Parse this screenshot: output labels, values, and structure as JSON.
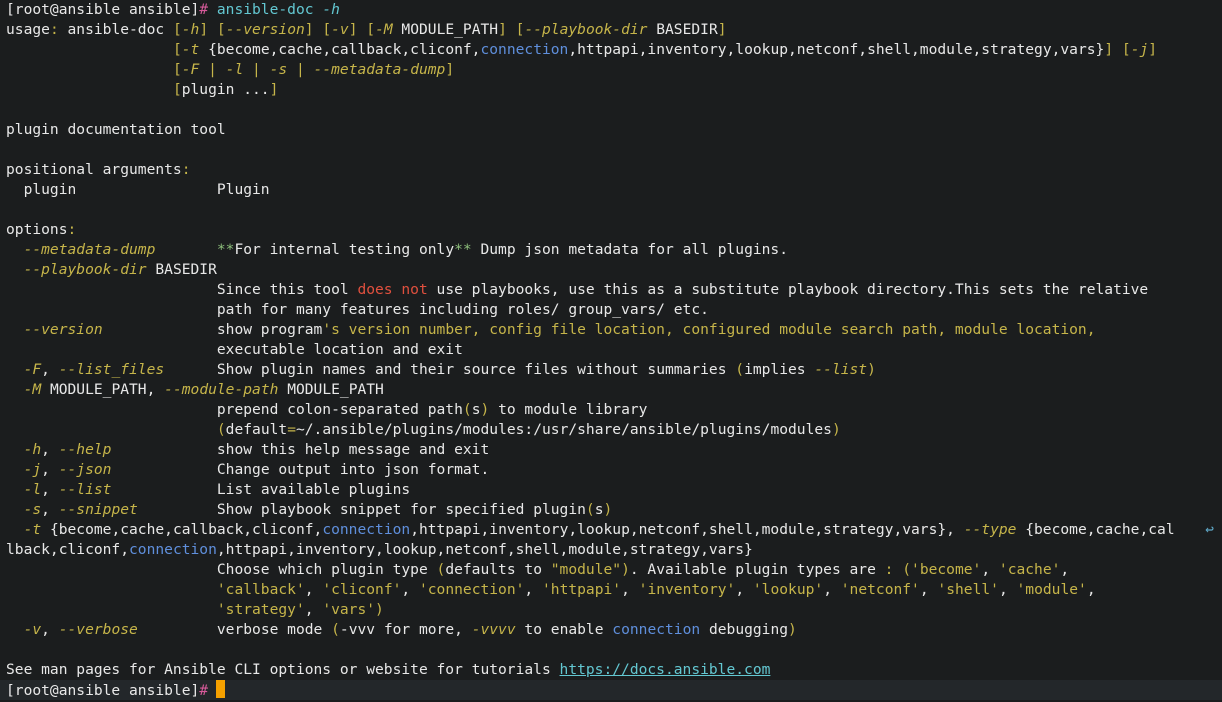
{
  "colors": {
    "background": "#1b1d1e",
    "text": "#e8e8e8",
    "yellow": "#c6b54a",
    "blue": "#5f8fdc",
    "red": "#e0503e",
    "green": "#8ec07c",
    "prompt_hash": "#d75a9a",
    "command": "#63c7d1",
    "cursor": "#f5a100"
  },
  "icons": {
    "line_wrap": "↩",
    "cursor": "block-cursor"
  },
  "lines": [
    [
      {
        "t": "[root@ansible ansible]",
        "c": "w"
      },
      {
        "t": "# ",
        "c": "pk"
      },
      {
        "t": "ansible-doc ",
        "c": "cy"
      },
      {
        "t": "-h",
        "c": "cyi"
      }
    ],
    [
      {
        "t": "usage",
        "c": "w"
      },
      {
        "t": ": ",
        "c": "y"
      },
      {
        "t": "ansible-doc ",
        "c": "w"
      },
      {
        "t": "[",
        "c": "y"
      },
      {
        "t": "-h",
        "c": "yi"
      },
      {
        "t": "] [",
        "c": "y"
      },
      {
        "t": "--version",
        "c": "yi"
      },
      {
        "t": "] [",
        "c": "y"
      },
      {
        "t": "-v",
        "c": "yi"
      },
      {
        "t": "] [",
        "c": "y"
      },
      {
        "t": "-M",
        "c": "yi"
      },
      {
        "t": " MODULE_PATH",
        "c": "w"
      },
      {
        "t": "] [",
        "c": "y"
      },
      {
        "t": "--playbook-dir",
        "c": "yi"
      },
      {
        "t": " BASEDIR",
        "c": "w"
      },
      {
        "t": "]",
        "c": "y"
      }
    ],
    [
      {
        "t": "                   ",
        "c": "w"
      },
      {
        "t": "[",
        "c": "y"
      },
      {
        "t": "-t",
        "c": "yi"
      },
      {
        "t": " {become,cache,callback,cliconf,",
        "c": "w"
      },
      {
        "t": "connection",
        "c": "b"
      },
      {
        "t": ",httpapi,inventory,lookup,netconf,shell,module,strategy,vars}",
        "c": "w"
      },
      {
        "t": "] [",
        "c": "y"
      },
      {
        "t": "-j",
        "c": "yi"
      },
      {
        "t": "]",
        "c": "y"
      }
    ],
    [
      {
        "t": "                   ",
        "c": "w"
      },
      {
        "t": "[",
        "c": "y"
      },
      {
        "t": "-F",
        "c": "yi"
      },
      {
        "t": " | ",
        "c": "y"
      },
      {
        "t": "-l",
        "c": "yi"
      },
      {
        "t": " | ",
        "c": "y"
      },
      {
        "t": "-s",
        "c": "yi"
      },
      {
        "t": " | ",
        "c": "y"
      },
      {
        "t": "--metadata-dump",
        "c": "yi"
      },
      {
        "t": "]",
        "c": "y"
      }
    ],
    [
      {
        "t": "                   ",
        "c": "w"
      },
      {
        "t": "[",
        "c": "y"
      },
      {
        "t": "plugin ...",
        "c": "w"
      },
      {
        "t": "]",
        "c": "y"
      }
    ],
    [],
    [
      {
        "t": "plugin documentation tool",
        "c": "w"
      }
    ],
    [],
    [
      {
        "t": "positional arguments",
        "c": "w"
      },
      {
        "t": ":",
        "c": "y"
      }
    ],
    [
      {
        "t": "  plugin                Plugin",
        "c": "w"
      }
    ],
    [],
    [
      {
        "t": "options",
        "c": "w"
      },
      {
        "t": ":",
        "c": "y"
      }
    ],
    [
      {
        "t": "  ",
        "c": "w"
      },
      {
        "t": "--metadata-dump",
        "c": "yi"
      },
      {
        "t": "       ",
        "c": "w"
      },
      {
        "t": "**",
        "c": "g"
      },
      {
        "t": "For internal testing only",
        "c": "w"
      },
      {
        "t": "**",
        "c": "g"
      },
      {
        "t": " Dump json metadata for all plugins.",
        "c": "w"
      }
    ],
    [
      {
        "t": "  ",
        "c": "w"
      },
      {
        "t": "--playbook-dir",
        "c": "yi"
      },
      {
        "t": " BASEDIR",
        "c": "w"
      }
    ],
    [
      {
        "t": "                        Since this tool ",
        "c": "w"
      },
      {
        "t": "does not",
        "c": "r"
      },
      {
        "t": " use playbooks, use this as a substitute playbook directory.This sets the relative",
        "c": "w"
      }
    ],
    [
      {
        "t": "                        path for many features including roles/ group_vars/ etc.",
        "c": "w"
      }
    ],
    [
      {
        "t": "  ",
        "c": "w"
      },
      {
        "t": "--version",
        "c": "yi"
      },
      {
        "t": "             show program",
        "c": "w"
      },
      {
        "t": "'s version number, config file location, configured module search path, module location,",
        "c": "y"
      }
    ],
    [
      {
        "t": "                        executable location and exit",
        "c": "w"
      }
    ],
    [
      {
        "t": "  ",
        "c": "w"
      },
      {
        "t": "-F",
        "c": "yi"
      },
      {
        "t": ", ",
        "c": "w"
      },
      {
        "t": "--list_files",
        "c": "yi"
      },
      {
        "t": "      Show plugin names and their source files without summaries ",
        "c": "w"
      },
      {
        "t": "(",
        "c": "y"
      },
      {
        "t": "implies ",
        "c": "w"
      },
      {
        "t": "--list",
        "c": "yi"
      },
      {
        "t": ")",
        "c": "y"
      }
    ],
    [
      {
        "t": "  ",
        "c": "w"
      },
      {
        "t": "-M",
        "c": "yi"
      },
      {
        "t": " MODULE_PATH, ",
        "c": "w"
      },
      {
        "t": "--module-path",
        "c": "yi"
      },
      {
        "t": " MODULE_PATH",
        "c": "w"
      }
    ],
    [
      {
        "t": "                        prepend colon-separated path",
        "c": "w"
      },
      {
        "t": "(",
        "c": "y"
      },
      {
        "t": "s",
        "c": "w"
      },
      {
        "t": ")",
        "c": "y"
      },
      {
        "t": " to module library",
        "c": "w"
      }
    ],
    [
      {
        "t": "                        ",
        "c": "w"
      },
      {
        "t": "(",
        "c": "y"
      },
      {
        "t": "default",
        "c": "w"
      },
      {
        "t": "=",
        "c": "y"
      },
      {
        "t": "~/.ansible/plugins/modules:/usr/share/ansible/plugins/modules",
        "c": "w"
      },
      {
        "t": ")",
        "c": "y"
      }
    ],
    [
      {
        "t": "  ",
        "c": "w"
      },
      {
        "t": "-h",
        "c": "yi"
      },
      {
        "t": ", ",
        "c": "w"
      },
      {
        "t": "--help",
        "c": "yi"
      },
      {
        "t": "            show this help message and exit",
        "c": "w"
      }
    ],
    [
      {
        "t": "  ",
        "c": "w"
      },
      {
        "t": "-j",
        "c": "yi"
      },
      {
        "t": ", ",
        "c": "w"
      },
      {
        "t": "--json",
        "c": "yi"
      },
      {
        "t": "            Change output into json format.",
        "c": "w"
      }
    ],
    [
      {
        "t": "  ",
        "c": "w"
      },
      {
        "t": "-l",
        "c": "yi"
      },
      {
        "t": ", ",
        "c": "w"
      },
      {
        "t": "--list",
        "c": "yi"
      },
      {
        "t": "            List available plugins",
        "c": "w"
      }
    ],
    [
      {
        "t": "  ",
        "c": "w"
      },
      {
        "t": "-s",
        "c": "yi"
      },
      {
        "t": ", ",
        "c": "w"
      },
      {
        "t": "--snippet",
        "c": "yi"
      },
      {
        "t": "         Show playbook snippet for specified plugin",
        "c": "w"
      },
      {
        "t": "(",
        "c": "y"
      },
      {
        "t": "s",
        "c": "w"
      },
      {
        "t": ")",
        "c": "y"
      }
    ],
    [
      {
        "t": "  ",
        "c": "w"
      },
      {
        "t": "-t",
        "c": "yi"
      },
      {
        "t": " {become,cache,callback,cliconf,",
        "c": "w"
      },
      {
        "t": "connection",
        "c": "b"
      },
      {
        "t": ",httpapi,inventory,lookup,netconf,shell,module,strategy,vars}, ",
        "c": "w"
      },
      {
        "t": "--type",
        "c": "yi"
      },
      {
        "t": " {become,cache,cal",
        "c": "w"
      }
    ],
    [
      {
        "t": "lback,cliconf,",
        "c": "w"
      },
      {
        "t": "connection",
        "c": "b"
      },
      {
        "t": ",httpapi,inventory,lookup,netconf,shell,module,strategy,vars}",
        "c": "w"
      }
    ],
    [
      {
        "t": "                        Choose which plugin type ",
        "c": "w"
      },
      {
        "t": "(",
        "c": "y"
      },
      {
        "t": "defaults to ",
        "c": "w"
      },
      {
        "t": "\"module\"",
        "c": "y"
      },
      {
        "t": ")",
        "c": "y"
      },
      {
        "t": ". Available plugin types are ",
        "c": "w"
      },
      {
        "t": ": (",
        "c": "y"
      },
      {
        "t": "'become'",
        "c": "y"
      },
      {
        "t": ", ",
        "c": "w"
      },
      {
        "t": "'cache'",
        "c": "y"
      },
      {
        "t": ",",
        "c": "w"
      }
    ],
    [
      {
        "t": "                        ",
        "c": "w"
      },
      {
        "t": "'callback'",
        "c": "y"
      },
      {
        "t": ", ",
        "c": "w"
      },
      {
        "t": "'cliconf'",
        "c": "y"
      },
      {
        "t": ", ",
        "c": "w"
      },
      {
        "t": "'connection'",
        "c": "y"
      },
      {
        "t": ", ",
        "c": "w"
      },
      {
        "t": "'httpapi'",
        "c": "y"
      },
      {
        "t": ", ",
        "c": "w"
      },
      {
        "t": "'inventory'",
        "c": "y"
      },
      {
        "t": ", ",
        "c": "w"
      },
      {
        "t": "'lookup'",
        "c": "y"
      },
      {
        "t": ", ",
        "c": "w"
      },
      {
        "t": "'netconf'",
        "c": "y"
      },
      {
        "t": ", ",
        "c": "w"
      },
      {
        "t": "'shell'",
        "c": "y"
      },
      {
        "t": ", ",
        "c": "w"
      },
      {
        "t": "'module'",
        "c": "y"
      },
      {
        "t": ",",
        "c": "w"
      }
    ],
    [
      {
        "t": "                        ",
        "c": "w"
      },
      {
        "t": "'strategy'",
        "c": "y"
      },
      {
        "t": ", ",
        "c": "w"
      },
      {
        "t": "'vars'",
        "c": "y"
      },
      {
        "t": ")",
        "c": "y"
      }
    ],
    [
      {
        "t": "  ",
        "c": "w"
      },
      {
        "t": "-v",
        "c": "yi"
      },
      {
        "t": ", ",
        "c": "w"
      },
      {
        "t": "--verbose",
        "c": "yi"
      },
      {
        "t": "         verbose mode ",
        "c": "w"
      },
      {
        "t": "(",
        "c": "y"
      },
      {
        "t": "-vvv for more, ",
        "c": "w"
      },
      {
        "t": "-vvvv",
        "c": "yi"
      },
      {
        "t": " to enable ",
        "c": "w"
      },
      {
        "t": "connection",
        "c": "b"
      },
      {
        "t": " debugging",
        "c": "w"
      },
      {
        "t": ")",
        "c": "y"
      }
    ],
    [],
    [
      {
        "t": "See man pages for Ansible CLI options or website for tutorials ",
        "c": "w"
      },
      {
        "t": "https://docs.ansible.com",
        "c": "lnk"
      }
    ],
    [
      {
        "t": "[root@ansible ansible]",
        "c": "w"
      },
      {
        "t": "#",
        "c": "pk"
      }
    ]
  ]
}
